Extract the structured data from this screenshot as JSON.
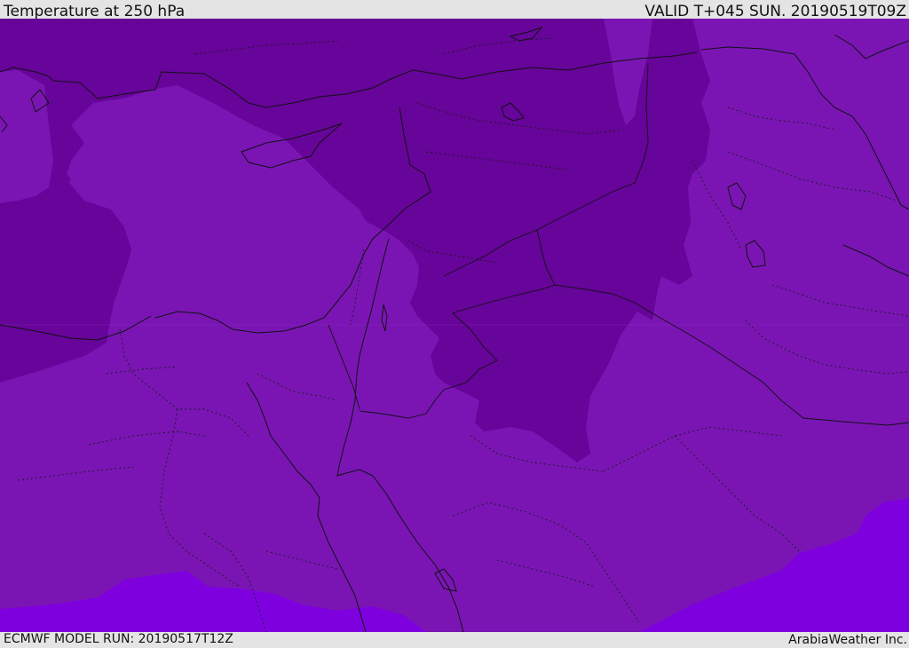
{
  "header": {
    "title": "Temperature at 250 hPa",
    "valid": "VALID T+045 SUN. 20190519T09Z"
  },
  "footer": {
    "model_run": "ECMWF MODEL RUN: 20190517T12Z",
    "credit": "ArabiaWeather Inc."
  },
  "map": {
    "colors": {
      "background": "#7a15b4",
      "cold_band": "#67049a",
      "warm_band": "#7e00de",
      "coastline": "#111111",
      "border": "#1a1a1a"
    }
  }
}
